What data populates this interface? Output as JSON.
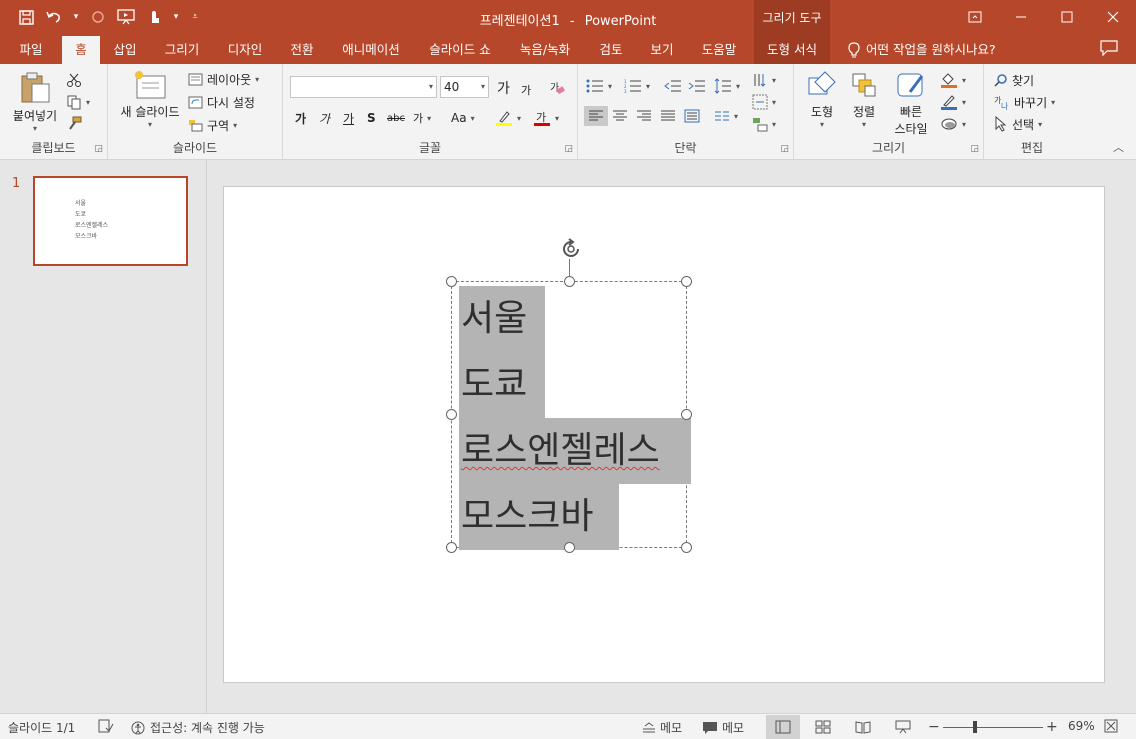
{
  "window": {
    "title_doc": "프레젠테이션1",
    "title_sep": "-",
    "title_app": "PowerPoint",
    "context_tab_group": "그리기 도구"
  },
  "qat": {
    "icons": [
      "save-icon",
      "undo-icon",
      "redo-icon",
      "present-icon",
      "touch-mode-icon",
      "customize-icon"
    ]
  },
  "tabs": [
    {
      "label": "파일"
    },
    {
      "label": "홈"
    },
    {
      "label": "삽입"
    },
    {
      "label": "그리기"
    },
    {
      "label": "디자인"
    },
    {
      "label": "전환"
    },
    {
      "label": "애니메이션"
    },
    {
      "label": "슬라이드 쇼"
    },
    {
      "label": "녹음/녹화"
    },
    {
      "label": "검토"
    },
    {
      "label": "보기"
    },
    {
      "label": "도움말"
    },
    {
      "label": "도형 서식"
    }
  ],
  "tell_me": "어떤 작업을 원하시나요?",
  "ribbon": {
    "clipboard": {
      "label": "클립보드",
      "paste": "붙여넣기"
    },
    "slides": {
      "label": "슬라이드",
      "new_slide": "새 슬라이드",
      "layout": "레이아웃",
      "reset": "다시 설정",
      "section": "구역"
    },
    "font": {
      "label": "글꼴",
      "font_name": "",
      "font_size": "40",
      "bold": "가",
      "italic": "가",
      "underline": "가",
      "shadow": "S",
      "strike": "abc",
      "spacing": "가",
      "case": "Aa",
      "grow": "가",
      "shrink": "가"
    },
    "paragraph": {
      "label": "단락"
    },
    "drawing": {
      "label": "그리기",
      "shapes": "도형",
      "arrange": "정렬",
      "quick_styles_1": "빠른",
      "quick_styles_2": "스타일"
    },
    "editing": {
      "label": "편집",
      "find": "찾기",
      "replace": "바꾸기",
      "select": "선택"
    }
  },
  "thumbnails": [
    {
      "number": "1",
      "lines": [
        "서울",
        "도쿄",
        "로스엔젤레스",
        "모스크바"
      ]
    }
  ],
  "slide": {
    "lines": [
      "서울",
      "도쿄",
      "로스엔젤레스",
      "모스크바"
    ]
  },
  "statusbar": {
    "slide_count": "슬라이드 1/1",
    "accessibility": "접근성: 계속 진행 가능",
    "notes": "메모",
    "comments": "메모",
    "zoom": "69%"
  }
}
